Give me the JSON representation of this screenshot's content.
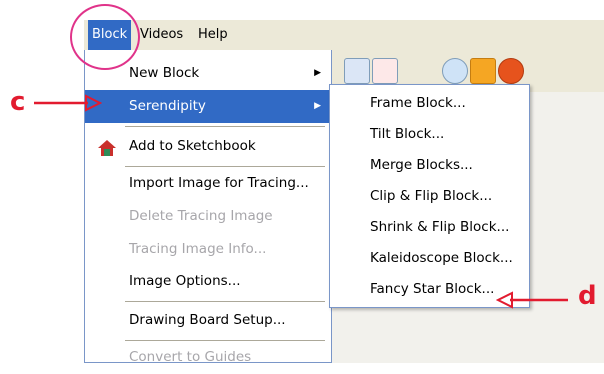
{
  "menubar": {
    "items": [
      "Block",
      "Videos",
      "Help"
    ]
  },
  "block_menu": {
    "items": [
      {
        "label": "New Block",
        "enabled": true,
        "submenu": true
      },
      {
        "label": "Serendipity",
        "enabled": true,
        "submenu": true,
        "highlighted": true
      },
      {
        "label": "Add to Sketchbook",
        "enabled": true
      },
      {
        "label": "Import Image for Tracing...",
        "enabled": true
      },
      {
        "label": "Delete Tracing Image",
        "enabled": false
      },
      {
        "label": "Tracing Image Info...",
        "enabled": false
      },
      {
        "label": "Image Options...",
        "enabled": true
      },
      {
        "label": "Drawing Board Setup...",
        "enabled": true
      },
      {
        "label": "Convert to Guides",
        "enabled": false
      }
    ]
  },
  "serendipity_submenu": {
    "items": [
      "Frame Block...",
      "Tilt Block...",
      "Merge Blocks...",
      "Clip & Flip Block...",
      "Shrink & Flip Block...",
      "Kaleidoscope Block...",
      "Fancy Star Block..."
    ]
  },
  "annotations": {
    "c_label": "c",
    "d_label": "d",
    "arrow_color": "#e21b2f",
    "circle_color": "#e0338a"
  },
  "colors": {
    "highlight": "#316ac5",
    "menubar_bg": "#ece9d8",
    "disabled_text": "#a7a6aa"
  }
}
